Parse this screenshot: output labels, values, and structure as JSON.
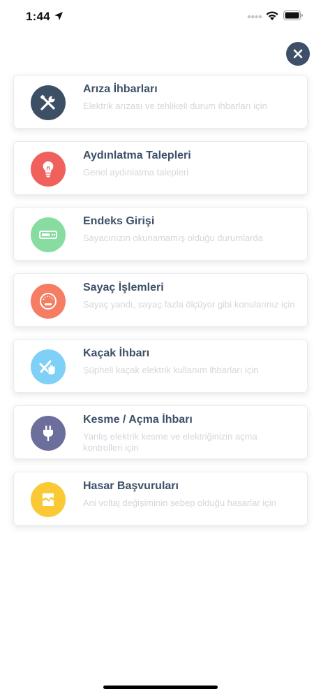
{
  "status_bar": {
    "time": "1:44",
    "icons": [
      "location-arrow-icon",
      "signal-icon",
      "wifi-icon",
      "battery-icon"
    ]
  },
  "close_button": {
    "icon": "close-icon",
    "color": "#3d5068"
  },
  "menu": {
    "items": [
      {
        "title": "Arıza İhbarları",
        "subtitle": "Elektrik arızası ve tehlikeli durum ihbarları için",
        "icon": "tools-icon",
        "color": "#3d4f64"
      },
      {
        "title": "Aydınlatma Talepleri",
        "subtitle": "Genel aydınlatma talepleri",
        "icon": "lightbulb-icon",
        "color": "#f0605d"
      },
      {
        "title": "Endeks Girişi",
        "subtitle": "Sayacınızın okunamamış olduğu durumlarda",
        "icon": "meter-icon",
        "color": "#87dca0"
      },
      {
        "title": "Sayaç İşlemleri",
        "subtitle": "Sayaç yandı, sayaç fazla ölçüyor gibi konularınız için",
        "icon": "gauge-icon",
        "color": "#f47d64"
      },
      {
        "title": "Kaçak İhbarı",
        "subtitle": "Şüpheli kaçak elektrik kullanım ihbarları için",
        "icon": "hand-cable-icon",
        "color": "#7ed0f6"
      },
      {
        "title": "Kesme / Açma İhbarı",
        "subtitle": "Yanlış elektrik kesme ve elektriğinizin açma kontrolleri için",
        "icon": "plug-icon",
        "color": "#6c6f9c"
      },
      {
        "title": "Hasar Başvuruları",
        "subtitle": "Ani voltaj değişiminin sebep olduğu hasarlar için",
        "icon": "damage-icon",
        "color": "#fac935"
      }
    ]
  }
}
